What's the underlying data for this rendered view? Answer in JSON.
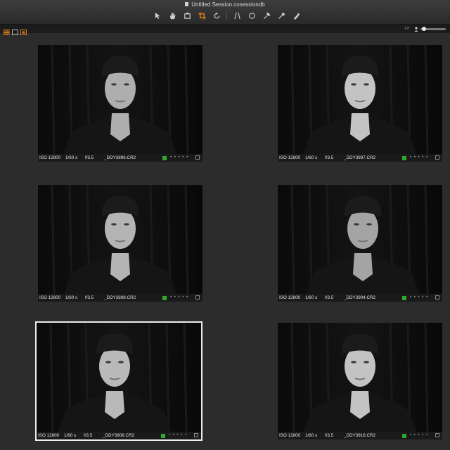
{
  "window": {
    "title": "Untitled Session.cosessiondb"
  },
  "toolbar": {
    "tools": [
      "pointer-icon",
      "hand-icon",
      "loupe-icon",
      "crop-icon",
      "rotate-icon",
      "keystone-icon",
      "circle-icon",
      "picker-icon",
      "brush-icon",
      "eraser-icon"
    ]
  },
  "subbar": {
    "filter_label": "FIT"
  },
  "accent": "#e07b1a",
  "tag_color": "#2ea82e",
  "thumbnails": [
    {
      "iso": "ISO 12800",
      "shutter": "1/60 s",
      "aperture": "f/3.5",
      "filename": "_DDY3896.CR2",
      "dots": "• • • • •",
      "selected": false
    },
    {
      "iso": "ISO 12800",
      "shutter": "1/60 s",
      "aperture": "f/3.5",
      "filename": "_DDY3897.CR2",
      "dots": "• • • • •",
      "selected": false
    },
    {
      "iso": "ISO 12800",
      "shutter": "1/60 s",
      "aperture": "f/3.5",
      "filename": "_DDY3898.CR2",
      "dots": "• • • • •",
      "selected": false
    },
    {
      "iso": "ISO 12800",
      "shutter": "1/60 s",
      "aperture": "f/3.5",
      "filename": "_DDY3904.CR2",
      "dots": "• • • • •",
      "selected": false
    },
    {
      "iso": "ISO 12800",
      "shutter": "1/60 s",
      "aperture": "f/3.5",
      "filename": "_DDY3906.CR2",
      "dots": "• • • • •",
      "selected": true
    },
    {
      "iso": "ISO 12800",
      "shutter": "1/60 s",
      "aperture": "f/3.5",
      "filename": "_DDY3916.CR2",
      "dots": "• • • • •",
      "selected": false
    }
  ]
}
